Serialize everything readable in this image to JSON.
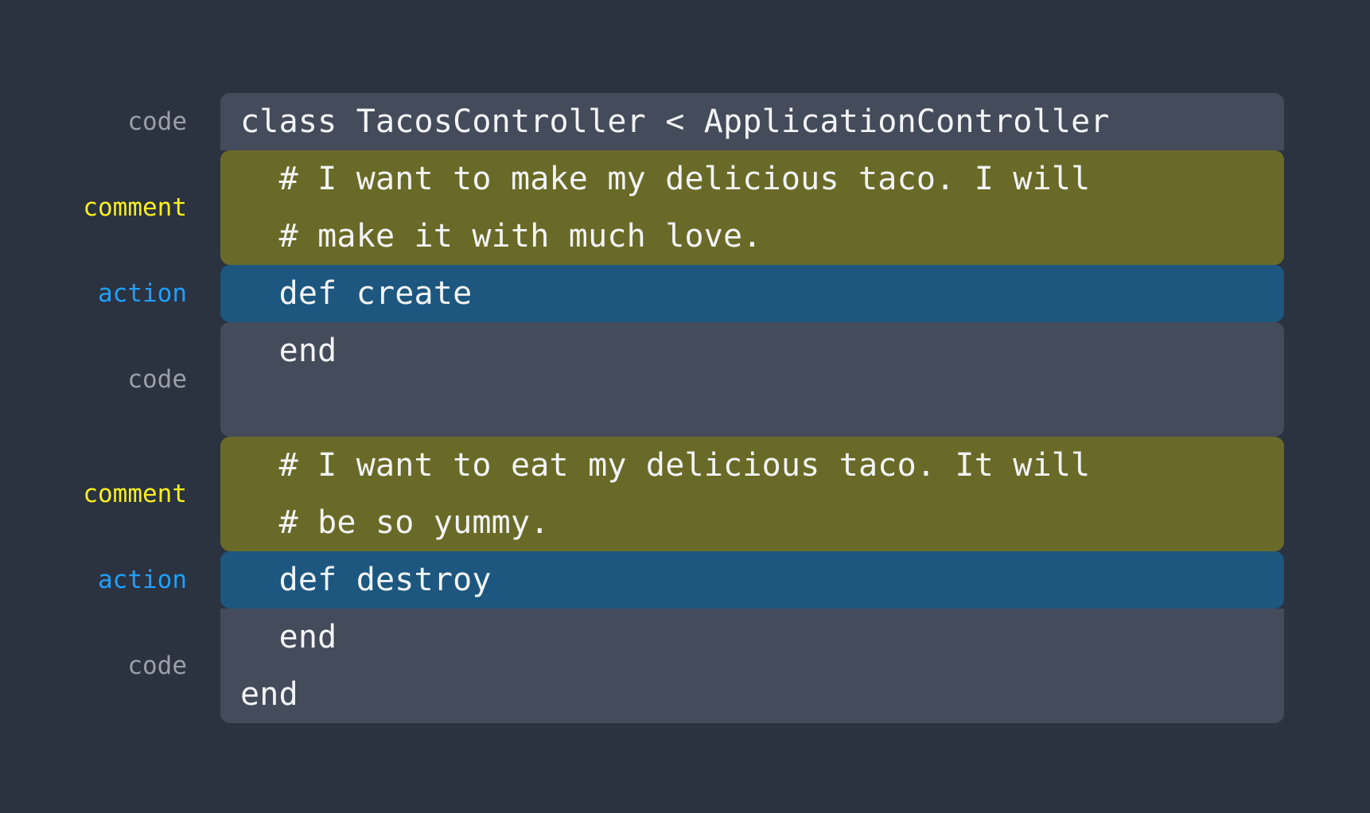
{
  "theme": {
    "page_background": "#2b3240",
    "code_block_background": "#444b5a",
    "comment_block_background": "#6a6a28",
    "action_block_background": "#1d577f",
    "code_text_color": "#f2f4f6",
    "label_code_color": "#9aa0a8",
    "label_comment_color": "#f8ef1e",
    "label_action_color": "#20a0fb"
  },
  "labels": {
    "code": "code",
    "comment": "comment",
    "action": "action"
  },
  "blocks": [
    {
      "kind": "code",
      "label": "code",
      "lines": [
        "class TacosController < ApplicationController"
      ]
    },
    {
      "kind": "comment",
      "label": "comment",
      "lines": [
        "  # I want to make my delicious taco. I will",
        "  # make it with much love."
      ]
    },
    {
      "kind": "action",
      "label": "action",
      "lines": [
        "  def create"
      ]
    },
    {
      "kind": "code",
      "label": "code",
      "lines": [
        "  end",
        ""
      ]
    },
    {
      "kind": "comment",
      "label": "comment",
      "lines": [
        "  # I want to eat my delicious taco. It will",
        "  # be so yummy."
      ]
    },
    {
      "kind": "action",
      "label": "action",
      "lines": [
        "  def destroy"
      ]
    },
    {
      "kind": "code",
      "label": "code",
      "lines": [
        "  end",
        "end"
      ]
    }
  ]
}
